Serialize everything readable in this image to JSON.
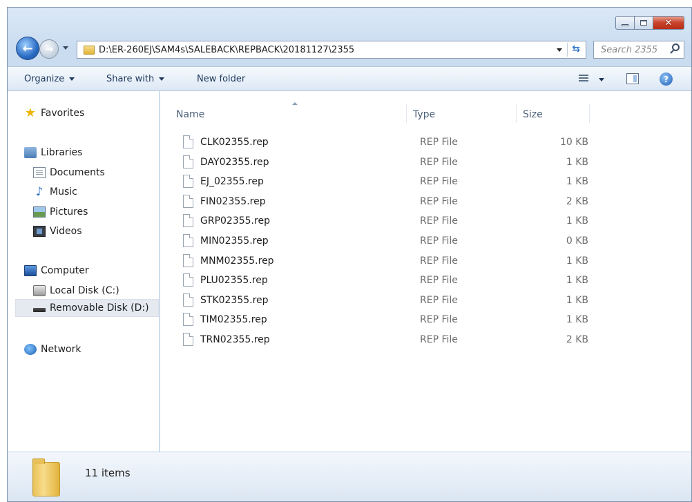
{
  "window": {
    "caption_buttons": {
      "minimize": "minimize",
      "maximize": "maximize",
      "close": "✕"
    }
  },
  "address_bar": {
    "path": "D:\\ER-260EJ\\SAM4s\\SALEBACK\\REPBACK\\20181127\\2355",
    "refresh_glyph": "⇆"
  },
  "search": {
    "placeholder": "Search 2355"
  },
  "toolbar": {
    "organize": "Organize",
    "share_with": "Share with",
    "new_folder": "New folder",
    "help_glyph": "?"
  },
  "sidebar": {
    "favorites": "Favorites",
    "libraries": "Libraries",
    "documents": "Documents",
    "music": "Music",
    "pictures": "Pictures",
    "videos": "Videos",
    "computer": "Computer",
    "local_disk": "Local Disk (C:)",
    "removable_disk": "Removable Disk (D:)",
    "network": "Network"
  },
  "columns": {
    "name": "Name",
    "type": "Type",
    "size": "Size"
  },
  "files": [
    {
      "name": "CLK02355.rep",
      "type": "REP File",
      "size": "10 KB"
    },
    {
      "name": "DAY02355.rep",
      "type": "REP File",
      "size": "1 KB"
    },
    {
      "name": "EJ_02355.rep",
      "type": "REP File",
      "size": "1 KB"
    },
    {
      "name": "FIN02355.rep",
      "type": "REP File",
      "size": "2 KB"
    },
    {
      "name": "GRP02355.rep",
      "type": "REP File",
      "size": "1 KB"
    },
    {
      "name": "MIN02355.rep",
      "type": "REP File",
      "size": "0 KB"
    },
    {
      "name": "MNM02355.rep",
      "type": "REP File",
      "size": "1 KB"
    },
    {
      "name": "PLU02355.rep",
      "type": "REP File",
      "size": "1 KB"
    },
    {
      "name": "STK02355.rep",
      "type": "REP File",
      "size": "1 KB"
    },
    {
      "name": "TIM02355.rep",
      "type": "REP File",
      "size": "1 KB"
    },
    {
      "name": "TRN02355.rep",
      "type": "REP File",
      "size": "2 KB"
    }
  ],
  "details": {
    "item_count": "11 items"
  }
}
